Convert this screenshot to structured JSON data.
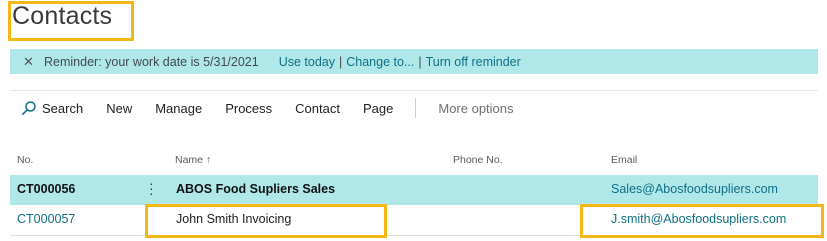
{
  "page": {
    "title": "Contacts"
  },
  "reminder": {
    "text": "Reminder: your work date is 5/31/2021",
    "use_today": "Use today",
    "change_to": "Change to...",
    "turn_off": "Turn off reminder"
  },
  "toolbar": {
    "search_label": "Search",
    "new_label": "New",
    "manage_label": "Manage",
    "process_label": "Process",
    "contact_label": "Contact",
    "page_label": "Page",
    "more_label": "More options"
  },
  "columns": {
    "no": "No.",
    "name": "Name ↑",
    "phone": "Phone No.",
    "email": "Email"
  },
  "rows": [
    {
      "no": "CT000056",
      "name": "ABOS Food Supliers  Sales",
      "phone": "",
      "email": "Sales@Abosfoodsupliers.com"
    },
    {
      "no": "CT000057",
      "name": "John  Smith Invoicing",
      "phone": "",
      "email": "J.smith@Abosfoodsupliers.com"
    }
  ],
  "colors": {
    "accent": "#0f6f84",
    "selection": "#b0e8ea",
    "highlight": "#f5b716"
  }
}
